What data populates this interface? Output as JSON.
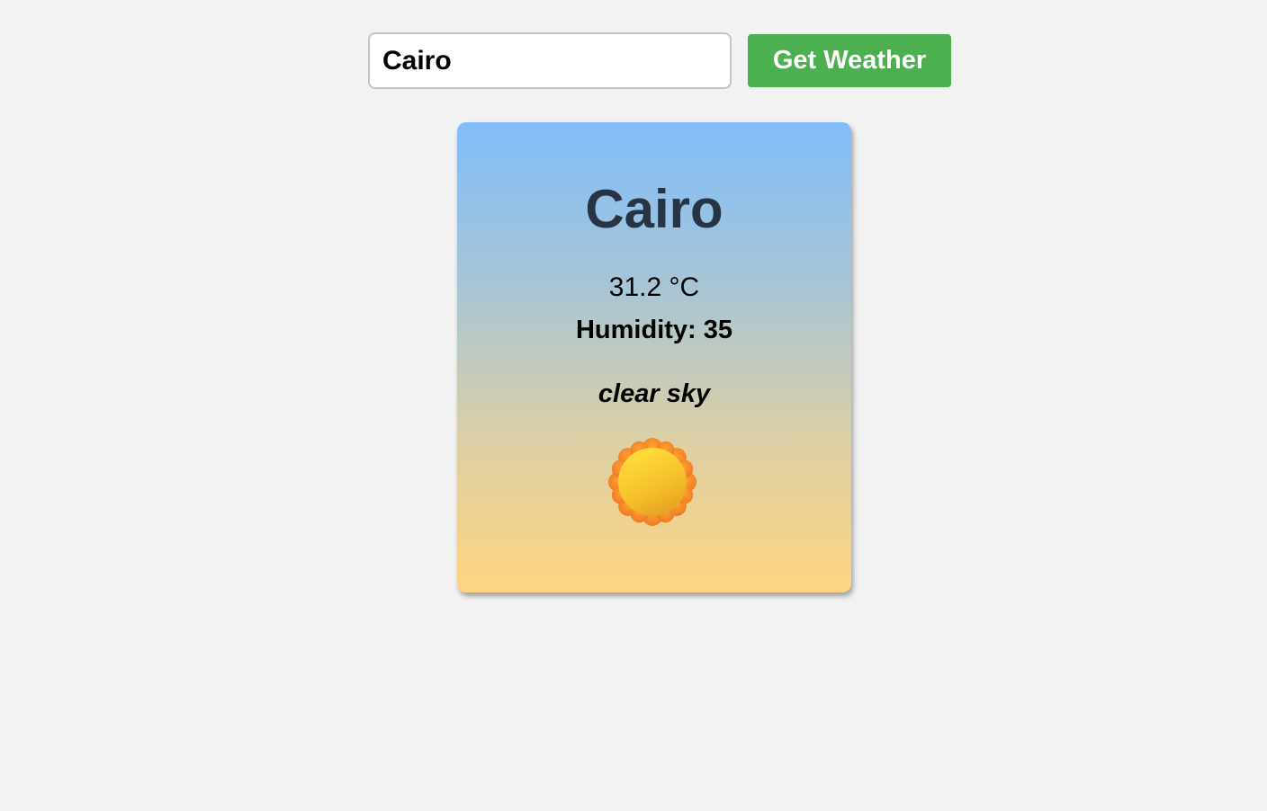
{
  "search": {
    "value": "Cairo",
    "button_label": "Get Weather"
  },
  "weather_card": {
    "city": "Cairo",
    "temperature": "31.2 °C",
    "humidity": "Humidity: 35",
    "description": "clear sky",
    "icon": "sun-icon"
  },
  "colors": {
    "button": "#4caf50",
    "card_top": "#80bdfb",
    "card_bottom": "#ffd480",
    "city_text": "#263445"
  }
}
